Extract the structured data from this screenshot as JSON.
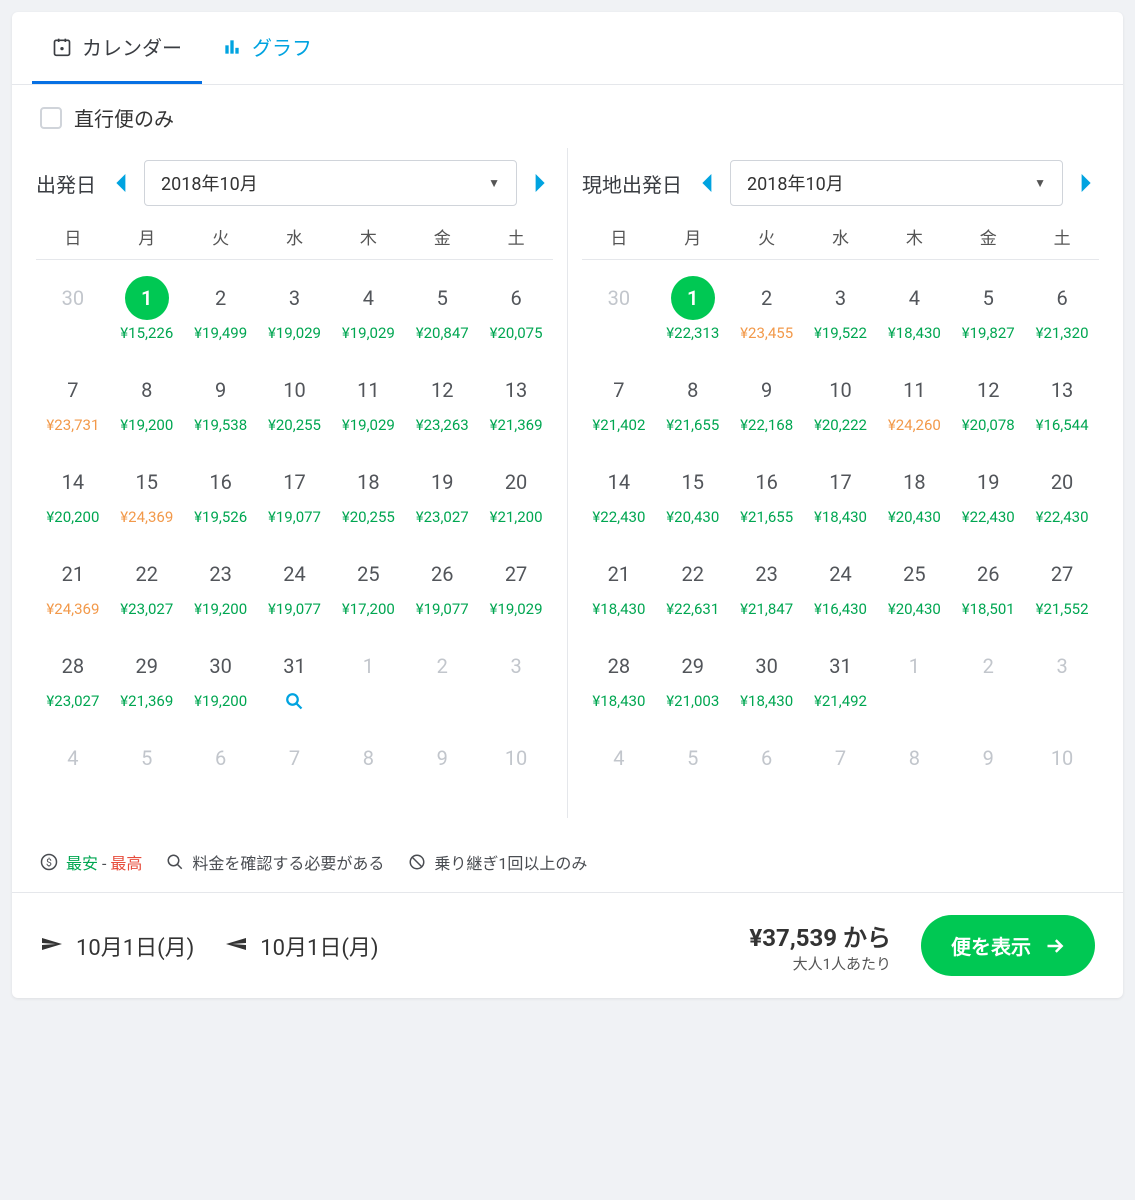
{
  "tabs": {
    "calendar": "カレンダー",
    "graph": "グラフ"
  },
  "filters": {
    "direct_only": "直行便のみ"
  },
  "weekdays": [
    "日",
    "月",
    "火",
    "水",
    "木",
    "金",
    "土"
  ],
  "departure": {
    "label": "出発日",
    "month": "2018年10月",
    "cells": [
      {
        "d": "30",
        "out": true
      },
      {
        "d": "1",
        "sel": true,
        "p": "¥15,226",
        "c": "green"
      },
      {
        "d": "2",
        "p": "¥19,499",
        "c": "green"
      },
      {
        "d": "3",
        "p": "¥19,029",
        "c": "green"
      },
      {
        "d": "4",
        "p": "¥19,029",
        "c": "green"
      },
      {
        "d": "5",
        "p": "¥20,847",
        "c": "green"
      },
      {
        "d": "6",
        "p": "¥20,075",
        "c": "green"
      },
      {
        "d": "7",
        "p": "¥23,731",
        "c": "orange"
      },
      {
        "d": "8",
        "p": "¥19,200",
        "c": "green"
      },
      {
        "d": "9",
        "p": "¥19,538",
        "c": "green"
      },
      {
        "d": "10",
        "p": "¥20,255",
        "c": "green"
      },
      {
        "d": "11",
        "p": "¥19,029",
        "c": "green"
      },
      {
        "d": "12",
        "p": "¥23,263",
        "c": "green"
      },
      {
        "d": "13",
        "p": "¥21,369",
        "c": "green"
      },
      {
        "d": "14",
        "p": "¥20,200",
        "c": "green"
      },
      {
        "d": "15",
        "p": "¥24,369",
        "c": "orange"
      },
      {
        "d": "16",
        "p": "¥19,526",
        "c": "green"
      },
      {
        "d": "17",
        "p": "¥19,077",
        "c": "green"
      },
      {
        "d": "18",
        "p": "¥20,255",
        "c": "green"
      },
      {
        "d": "19",
        "p": "¥23,027",
        "c": "green"
      },
      {
        "d": "20",
        "p": "¥21,200",
        "c": "green"
      },
      {
        "d": "21",
        "p": "¥24,369",
        "c": "orange"
      },
      {
        "d": "22",
        "p": "¥23,027",
        "c": "green"
      },
      {
        "d": "23",
        "p": "¥19,200",
        "c": "green"
      },
      {
        "d": "24",
        "p": "¥19,077",
        "c": "green"
      },
      {
        "d": "25",
        "p": "¥17,200",
        "c": "green"
      },
      {
        "d": "26",
        "p": "¥19,077",
        "c": "green"
      },
      {
        "d": "27",
        "p": "¥19,029",
        "c": "green"
      },
      {
        "d": "28",
        "p": "¥23,027",
        "c": "green"
      },
      {
        "d": "29",
        "p": "¥21,369",
        "c": "green"
      },
      {
        "d": "30",
        "p": "¥19,200",
        "c": "green"
      },
      {
        "d": "31",
        "search": true
      },
      {
        "d": "1",
        "out": true
      },
      {
        "d": "2",
        "out": true
      },
      {
        "d": "3",
        "out": true
      },
      {
        "d": "4",
        "out": true
      },
      {
        "d": "5",
        "out": true
      },
      {
        "d": "6",
        "out": true
      },
      {
        "d": "7",
        "out": true
      },
      {
        "d": "8",
        "out": true
      },
      {
        "d": "9",
        "out": true
      },
      {
        "d": "10",
        "out": true
      }
    ]
  },
  "return": {
    "label": "現地出発日",
    "month": "2018年10月",
    "cells": [
      {
        "d": "30",
        "out": true
      },
      {
        "d": "1",
        "sel": true,
        "p": "¥22,313",
        "c": "green"
      },
      {
        "d": "2",
        "p": "¥23,455",
        "c": "orange"
      },
      {
        "d": "3",
        "p": "¥19,522",
        "c": "green"
      },
      {
        "d": "4",
        "p": "¥18,430",
        "c": "green"
      },
      {
        "d": "5",
        "p": "¥19,827",
        "c": "green"
      },
      {
        "d": "6",
        "p": "¥21,320",
        "c": "green"
      },
      {
        "d": "7",
        "p": "¥21,402",
        "c": "green"
      },
      {
        "d": "8",
        "p": "¥21,655",
        "c": "green"
      },
      {
        "d": "9",
        "p": "¥22,168",
        "c": "green"
      },
      {
        "d": "10",
        "p": "¥20,222",
        "c": "green"
      },
      {
        "d": "11",
        "p": "¥24,260",
        "c": "orange"
      },
      {
        "d": "12",
        "p": "¥20,078",
        "c": "green"
      },
      {
        "d": "13",
        "p": "¥16,544",
        "c": "green"
      },
      {
        "d": "14",
        "p": "¥22,430",
        "c": "green"
      },
      {
        "d": "15",
        "p": "¥20,430",
        "c": "green"
      },
      {
        "d": "16",
        "p": "¥21,655",
        "c": "green"
      },
      {
        "d": "17",
        "p": "¥18,430",
        "c": "green"
      },
      {
        "d": "18",
        "p": "¥20,430",
        "c": "green"
      },
      {
        "d": "19",
        "p": "¥22,430",
        "c": "green"
      },
      {
        "d": "20",
        "p": "¥22,430",
        "c": "green"
      },
      {
        "d": "21",
        "p": "¥18,430",
        "c": "green"
      },
      {
        "d": "22",
        "p": "¥22,631",
        "c": "green"
      },
      {
        "d": "23",
        "p": "¥21,847",
        "c": "green"
      },
      {
        "d": "24",
        "p": "¥16,430",
        "c": "green"
      },
      {
        "d": "25",
        "p": "¥20,430",
        "c": "green"
      },
      {
        "d": "26",
        "p": "¥18,501",
        "c": "green"
      },
      {
        "d": "27",
        "p": "¥21,552",
        "c": "green"
      },
      {
        "d": "28",
        "p": "¥18,430",
        "c": "green"
      },
      {
        "d": "29",
        "p": "¥21,003",
        "c": "green"
      },
      {
        "d": "30",
        "p": "¥18,430",
        "c": "green"
      },
      {
        "d": "31",
        "p": "¥21,492",
        "c": "green"
      },
      {
        "d": "1",
        "out": true
      },
      {
        "d": "2",
        "out": true
      },
      {
        "d": "3",
        "out": true
      },
      {
        "d": "4",
        "out": true
      },
      {
        "d": "5",
        "out": true
      },
      {
        "d": "6",
        "out": true
      },
      {
        "d": "7",
        "out": true
      },
      {
        "d": "8",
        "out": true
      },
      {
        "d": "9",
        "out": true
      },
      {
        "d": "10",
        "out": true
      }
    ]
  },
  "legend": {
    "low": "最安",
    "dash": " - ",
    "high": "最高",
    "check_price": "料金を確認する必要がある",
    "transfer_only": "乗り継ぎ1回以上のみ"
  },
  "footer": {
    "dep_date": "10月1日(月)",
    "ret_date": "10月1日(月)",
    "total": "¥37,539 から",
    "per": "大人1人あたり",
    "cta": "便を表示"
  }
}
